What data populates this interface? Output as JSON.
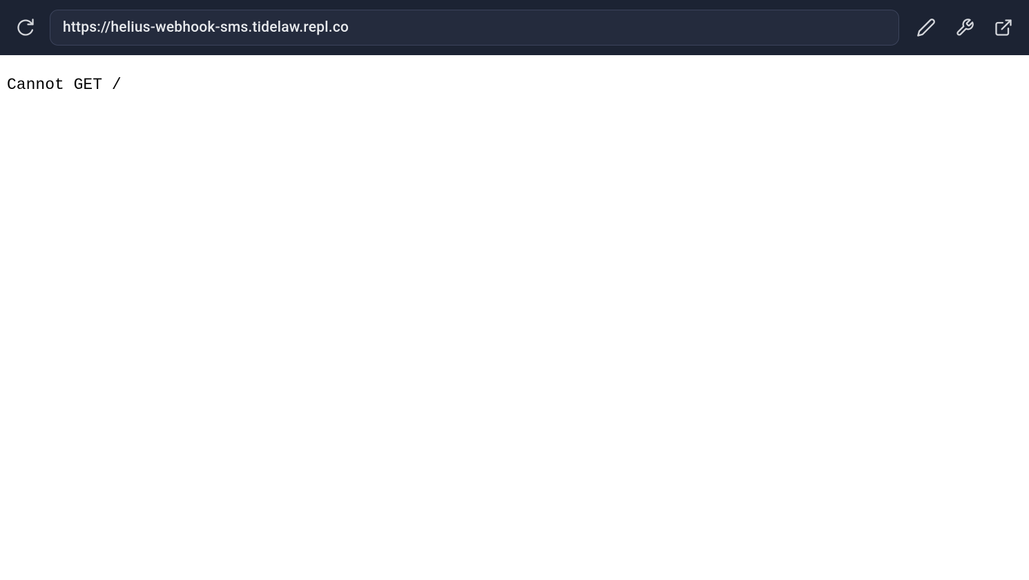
{
  "toolbar": {
    "url": "https://helius-webhook-sms.tidelaw.repl.co"
  },
  "content": {
    "message": "Cannot GET /"
  }
}
